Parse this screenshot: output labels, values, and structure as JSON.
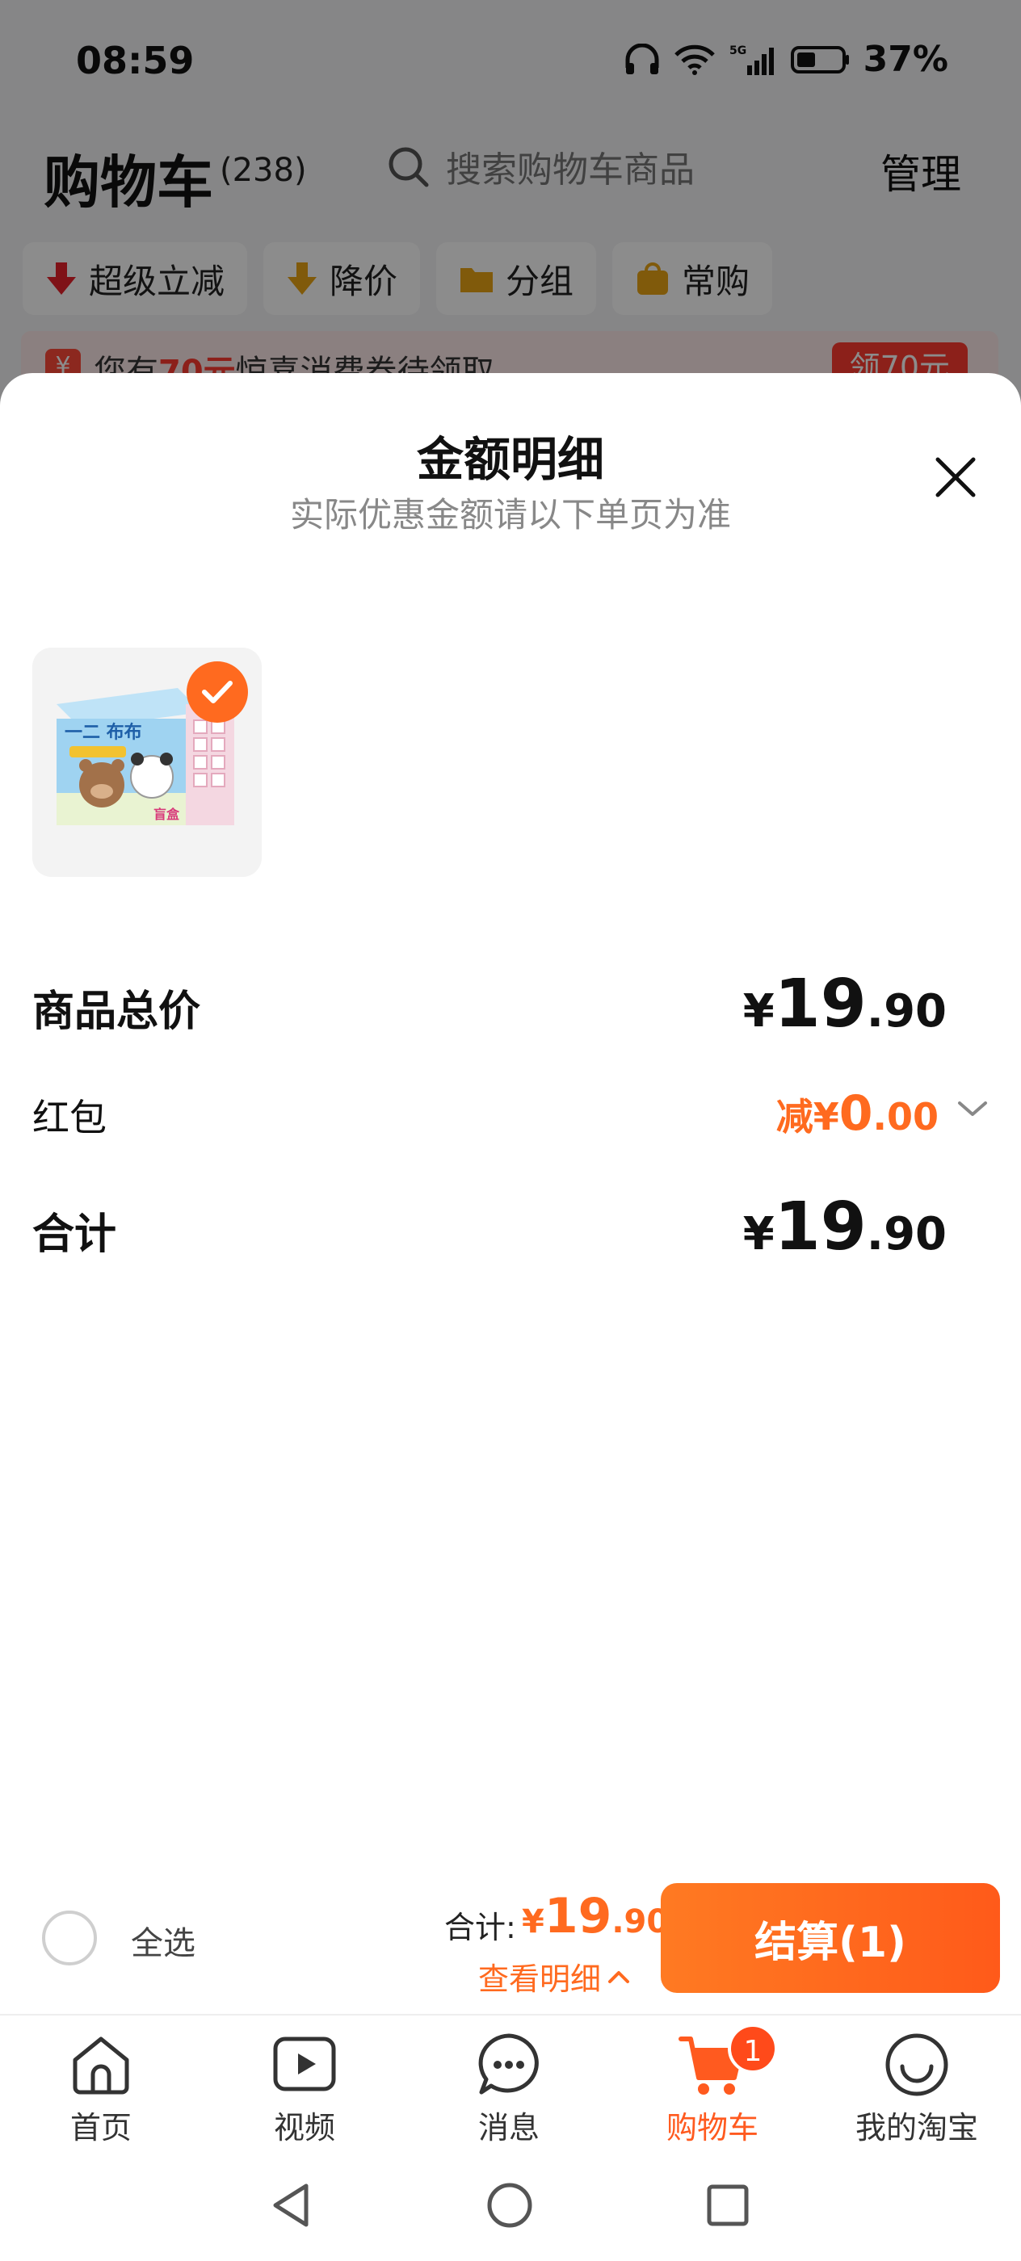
{
  "status_bar": {
    "time": "08:59",
    "battery": "37%",
    "network": "5G"
  },
  "cart_header": {
    "title": "购物车",
    "count": "(238)",
    "search_placeholder": "搜索购物车商品",
    "manage": "管理"
  },
  "filters": [
    {
      "label": "超级立减",
      "icon": "red-down-arrow-icon"
    },
    {
      "label": "降价",
      "icon": "orange-down-arrow-icon"
    },
    {
      "label": "分组",
      "icon": "folder-icon"
    },
    {
      "label": "常购",
      "icon": "bag-icon"
    }
  ],
  "promo": {
    "prefix": "您有",
    "amount": "70元",
    "suffix": "惊喜消费券待领取",
    "button": "领70元"
  },
  "sheet": {
    "title": "金额明细",
    "subtitle": "实际优惠金额请以下单页为准",
    "product_thumb": "product-blind-box-image",
    "rows": {
      "goods_total": {
        "label": "商品总价",
        "currency": "¥",
        "int": "19",
        "dec": ".90"
      },
      "red_packet": {
        "label": "红包",
        "prefix": "减¥",
        "int": "0",
        "dec": ".00"
      },
      "total": {
        "label": "合计",
        "currency": "¥",
        "int": "19",
        "dec": ".90"
      }
    }
  },
  "checkout": {
    "select_all": "全选",
    "total_label": "合计:",
    "currency": "¥",
    "total_int": "19",
    "total_dec": ".90",
    "detail_link": "查看明细",
    "pay_button": "结算(1)"
  },
  "tabs": [
    {
      "label": "首页",
      "icon": "home-icon"
    },
    {
      "label": "视频",
      "icon": "video-icon"
    },
    {
      "label": "消息",
      "icon": "message-icon"
    },
    {
      "label": "购物车",
      "icon": "cart-icon",
      "badge": "1",
      "active": true
    },
    {
      "label": "我的淘宝",
      "icon": "smile-icon"
    }
  ],
  "colors": {
    "accent": "#ff6a1f",
    "promo_red": "#ff3b30",
    "text": "#111111",
    "muted": "#888888"
  }
}
